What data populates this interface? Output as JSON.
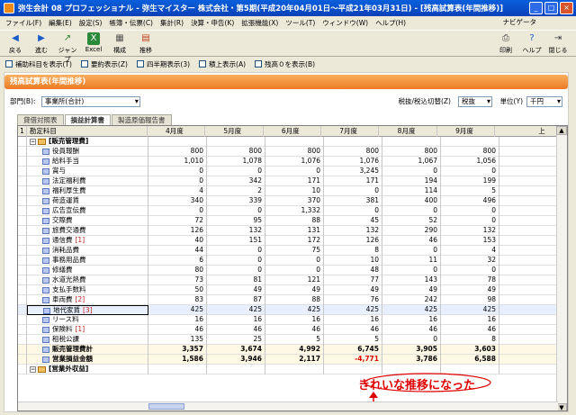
{
  "window": {
    "title": "弥生会計 08 プロフェッショナル - 弥生マイスター 株式会社・第5期(平成20年04月01日～平成21年03月31日) - [残高試算表(年間推移)]"
  },
  "menu": [
    "ファイル(F)",
    "編集(E)",
    "設定(S)",
    "帳簿・伝票(C)",
    "集計(R)",
    "決算・申告(K)",
    "拡張機能(X)",
    "ツール(T)",
    "ウィンドウ(W)",
    "ヘルプ(H)"
  ],
  "navi_label": "ナビゲータ",
  "toolbar": {
    "back": "戻る",
    "forward": "進む",
    "jump": "ジャンプ",
    "excel": "Excel",
    "config": "構成",
    "transition": "推移",
    "print": "印刷",
    "help": "ヘルプ",
    "close": "閉じる"
  },
  "options": [
    "補助科目を表示(T)",
    "要約表示(Z)",
    "四半期表示(3)",
    "積上表示(A)",
    "残高０を表示(B)"
  ],
  "header_title": "残高試算表(年間推移)",
  "filters": {
    "dept_label": "部門(B):",
    "dept_value": "事業所(合計)",
    "tax_label": "税抜/税込切替(Z)",
    "tax_value": "税抜",
    "unit_label": "単位(Y)",
    "unit_value": "千円"
  },
  "tabs": [
    "貸借対照表",
    "損益計算書",
    "製造原価報告書"
  ],
  "grid": {
    "columns": [
      "1",
      "勘定科目",
      "4月度",
      "5月度",
      "6月度",
      "7月度",
      "8月度",
      "9月度"
    ],
    "rows": [
      {
        "label": "[販売管理費]",
        "v": [
          "",
          "",
          "",
          "",
          "",
          ""
        ],
        "kind": "group"
      },
      {
        "label": "役員報酬",
        "v": [
          "800",
          "800",
          "800",
          "800",
          "800",
          "800"
        ]
      },
      {
        "label": "給料手当",
        "v": [
          "1,010",
          "1,078",
          "1,076",
          "1,076",
          "1,067",
          "1,056"
        ]
      },
      {
        "label": "賞与",
        "v": [
          "0",
          "0",
          "0",
          "3,245",
          "0",
          "0"
        ]
      },
      {
        "label": "法定福利費",
        "v": [
          "0",
          "342",
          "171",
          "171",
          "194",
          "199"
        ]
      },
      {
        "label": "福利厚生費",
        "v": [
          "4",
          "2",
          "10",
          "0",
          "114",
          "5"
        ]
      },
      {
        "label": "荷造運賃",
        "v": [
          "340",
          "339",
          "370",
          "381",
          "400",
          "496"
        ]
      },
      {
        "label": "広告宣伝費",
        "v": [
          "0",
          "0",
          "1,332",
          "0",
          "0",
          "0"
        ]
      },
      {
        "label": "交際費",
        "v": [
          "72",
          "95",
          "88",
          "45",
          "52",
          "0"
        ]
      },
      {
        "label": "旅費交通費",
        "v": [
          "126",
          "132",
          "131",
          "132",
          "290",
          "132"
        ]
      },
      {
        "label": "通信費",
        "tag": "[1]",
        "v": [
          "40",
          "151",
          "172",
          "126",
          "46",
          "153"
        ]
      },
      {
        "label": "消耗品費",
        "v": [
          "44",
          "0",
          "75",
          "8",
          "0",
          "4"
        ]
      },
      {
        "label": "事務用品費",
        "v": [
          "6",
          "0",
          "0",
          "10",
          "11",
          "32"
        ]
      },
      {
        "label": "修繕費",
        "v": [
          "80",
          "0",
          "0",
          "48",
          "0",
          "0"
        ]
      },
      {
        "label": "水道光熱費",
        "v": [
          "73",
          "81",
          "121",
          "77",
          "143",
          "78"
        ]
      },
      {
        "label": "支払手数料",
        "v": [
          "50",
          "49",
          "49",
          "49",
          "49",
          "49"
        ]
      },
      {
        "label": "車両費",
        "tag": "[2]",
        "v": [
          "83",
          "87",
          "88",
          "76",
          "242",
          "98"
        ]
      },
      {
        "label": "地代家賃",
        "tag": "[3]",
        "v": [
          "425",
          "425",
          "425",
          "425",
          "425",
          "425"
        ],
        "kind": "highlight"
      },
      {
        "label": "リース料",
        "v": [
          "16",
          "16",
          "16",
          "16",
          "16",
          "16"
        ]
      },
      {
        "label": "保険料",
        "tag": "[1]",
        "v": [
          "46",
          "46",
          "46",
          "46",
          "46",
          "46"
        ]
      },
      {
        "label": "租税公課",
        "v": [
          "135",
          "25",
          "5",
          "5",
          "0",
          "8"
        ]
      },
      {
        "label": "販売管理費計",
        "v": [
          "3,357",
          "3,674",
          "4,992",
          "6,745",
          "3,905",
          "3,603"
        ],
        "kind": "total"
      },
      {
        "label": "営業損益金額",
        "v": [
          "1,586",
          "3,946",
          "2,117",
          "-4,771",
          "3,786",
          "6,588"
        ],
        "kind": "total"
      },
      {
        "label": "[営業外収益]",
        "v": [
          "",
          "",
          "",
          "",
          "",
          ""
        ],
        "kind": "group"
      }
    ]
  },
  "annotation": "きれいな推移になった",
  "colors": {
    "title_bar": "#0a5fdc",
    "header_orange": "#ee7a22",
    "annotation": "#e00000"
  }
}
